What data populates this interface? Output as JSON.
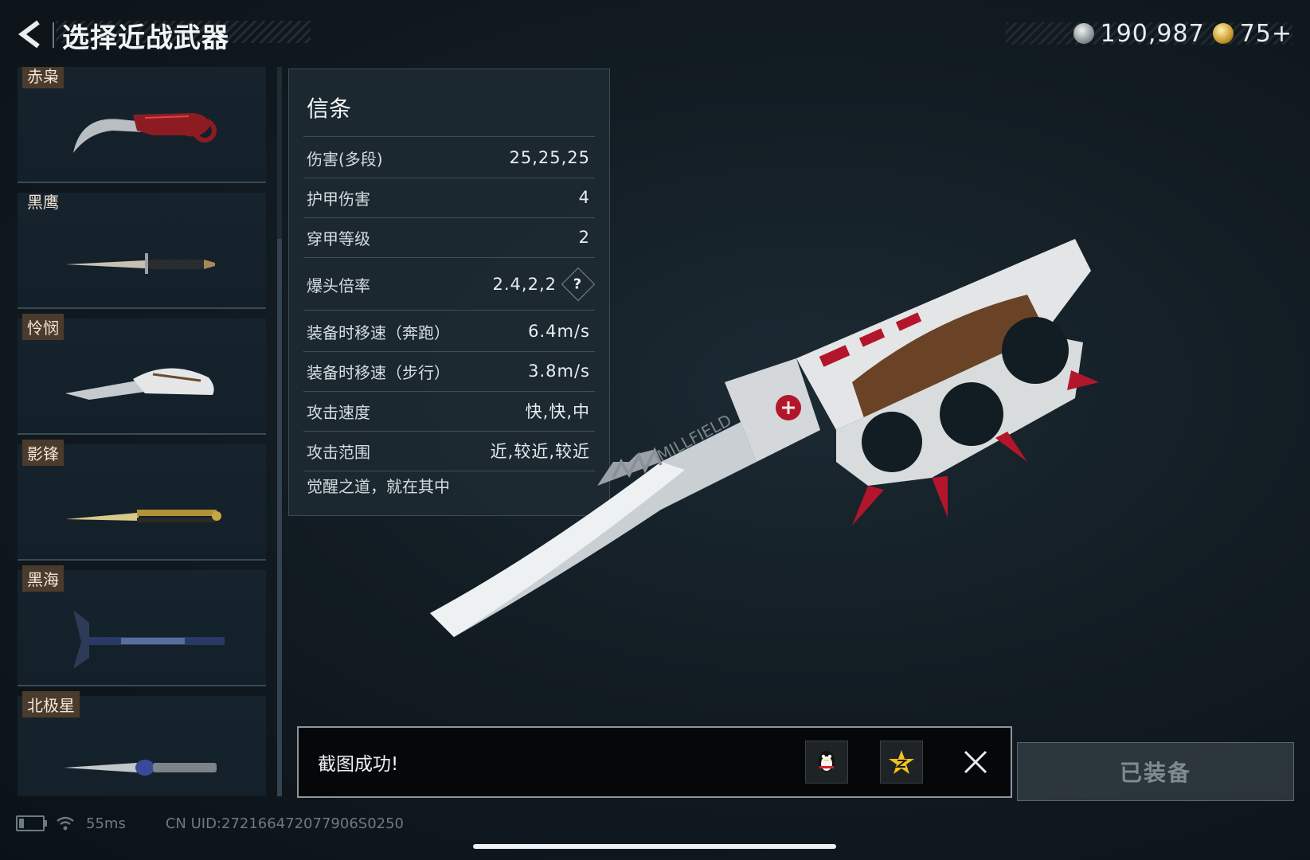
{
  "header": {
    "title": "选择近战武器",
    "silver_amount": "190,987",
    "gold_amount": "75+"
  },
  "weapons": [
    {
      "name": "赤枭",
      "icon": "karambit-knife-icon"
    },
    {
      "name": "黑鹰",
      "icon": "combat-knife-icon"
    },
    {
      "name": "怜悯",
      "icon": "folding-knife-icon"
    },
    {
      "name": "影锋",
      "icon": "butterfly-knife-icon"
    },
    {
      "name": "黑海",
      "icon": "tomahawk-axe-icon"
    },
    {
      "name": "北极星",
      "icon": "dagger-icon"
    }
  ],
  "stats": {
    "title": "信条",
    "rows": [
      {
        "label": "伤害(多段)",
        "value": "25,25,25"
      },
      {
        "label": "护甲伤害",
        "value": "4"
      },
      {
        "label": "穿甲等级",
        "value": "2"
      },
      {
        "label": "爆头倍率",
        "value": "2.4,2,2"
      },
      {
        "label": "装备时移速（奔跑）",
        "value": "6.4m/s"
      },
      {
        "label": "装备时移速（步行）",
        "value": "3.8m/s"
      },
      {
        "label": "攻击速度",
        "value": "快,快,中"
      },
      {
        "label": "攻击范围",
        "value": "近,较近,较近"
      }
    ],
    "description": "觉醒之道，就在其中",
    "help_symbol": "?"
  },
  "hero_engraving": "MILLFIELD",
  "toast": {
    "message": "截图成功!"
  },
  "equip_button": "已装备",
  "status": {
    "ping": "55ms",
    "uid": "CN UID:272166472077906S0250"
  }
}
